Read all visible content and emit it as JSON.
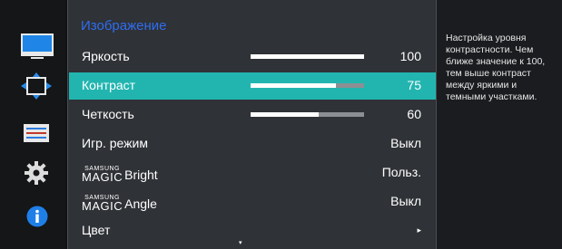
{
  "menu": {
    "title": "Изображение",
    "rows": [
      {
        "label": "Яркость",
        "value": "100",
        "level": 1.0
      },
      {
        "label": "Контраст",
        "value": "75",
        "level": 0.75
      },
      {
        "label": "Четкость",
        "value": "60",
        "level": 0.6
      },
      {
        "label": "Игр. режим",
        "value": "Выкл"
      },
      {
        "label": "Bright",
        "brand_small": "SAMSUNG",
        "brand_large": "MAGIC",
        "value": "Польз."
      },
      {
        "label": "Angle",
        "brand_small": "SAMSUNG",
        "brand_large": "MAGIC",
        "value": "Выкл"
      },
      {
        "label": "Цвет",
        "value": "▸"
      }
    ],
    "scroll_indicator": "▾"
  },
  "help": {
    "text": "Настройка уровня контрастности. Чем ближе значение к 100, тем выше контраст между яркими и темными участками."
  },
  "sidebar": {
    "icons": [
      "monitor-icon",
      "move-arrows-icon",
      "layers-icon",
      "gear-icon",
      "info-icon"
    ]
  },
  "colors": {
    "title": "#2f6df0",
    "selected_row": "#22b5b0",
    "background": "#2f3236"
  }
}
